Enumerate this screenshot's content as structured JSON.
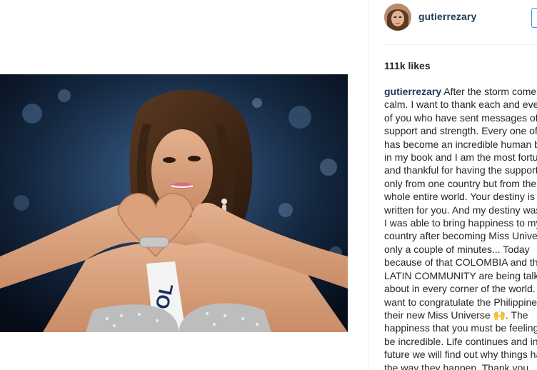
{
  "post": {
    "username": "gutierrezary",
    "likes": "111k likes",
    "caption_author": "gutierrezary",
    "caption_lines": [
      "After the storm comes",
      "calm. I want to thank each and every",
      "of you who have sent messages of",
      "support and strength. Every one of you",
      "has become an incredible human being",
      "in my book and I am the most fortunate",
      "and thankful for having the support not",
      "only from one country but from the",
      "whole entire world. Your destiny is",
      "written for you. And my destiny was that",
      "I was able to bring happiness to my",
      "country after becoming Miss Universe for",
      "only a couple of minutes... Today",
      "because of that COLOMBIA and the",
      "LATIN COMMUNITY are being talked",
      "about in every corner of the world. I",
      "want to congratulate the Philippines for",
      "their new Miss Universe 🙌. The",
      "happiness that you must be feeling must",
      "be incredible. Life continues and in the",
      "future we will find out why things happen",
      "the way they happen. Thank you"
    ],
    "photo_sash_text": "COL"
  },
  "colors": {
    "username": "#1f3a5a",
    "text": "#262626",
    "divider": "#efefef",
    "follow_border": "#3897f0"
  }
}
